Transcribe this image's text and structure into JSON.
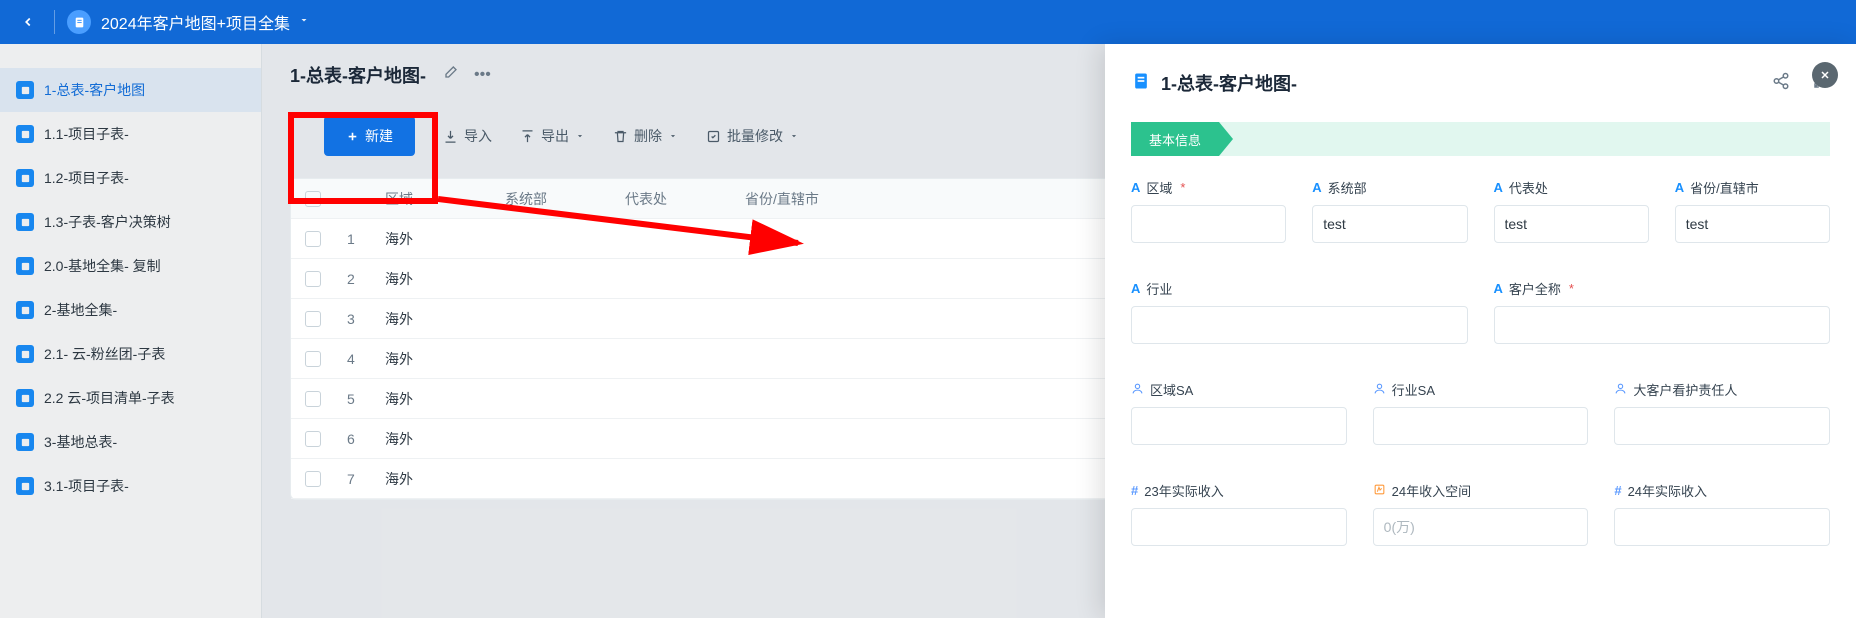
{
  "topbar": {
    "title": "2024年客户地图+项目全集"
  },
  "sidebar": {
    "items": [
      {
        "label": "1-总表-客户地图"
      },
      {
        "label": "1.1-项目子表-"
      },
      {
        "label": "1.2-项目子表-"
      },
      {
        "label": "1.3-子表-客户决策树"
      },
      {
        "label": "2.0-基地全集-      复制"
      },
      {
        "label": "2-基地全集-"
      },
      {
        "label": "2.1-    云-粉丝团-子表"
      },
      {
        "label": "2.2    云-项目清单-子表"
      },
      {
        "label": "3-基地总表-"
      },
      {
        "label": "3.1-项目子表-"
      }
    ]
  },
  "page": {
    "title": "1-总表-客户地图-"
  },
  "toolbar": {
    "new": "新建",
    "import": "导入",
    "export": "导出",
    "delete": "删除",
    "batch": "批量修改"
  },
  "table": {
    "headers": {
      "region": "区域",
      "sysdept": "系统部",
      "rep": "代表处",
      "province": "省份/直辖市"
    },
    "rows": [
      {
        "idx": "1",
        "region": "海外"
      },
      {
        "idx": "2",
        "region": "海外"
      },
      {
        "idx": "3",
        "region": "海外"
      },
      {
        "idx": "4",
        "region": "海外"
      },
      {
        "idx": "5",
        "region": "海外"
      },
      {
        "idx": "6",
        "region": "海外"
      },
      {
        "idx": "7",
        "region": "海外"
      }
    ]
  },
  "drawer": {
    "title": "1-总表-客户地图-",
    "section": "基本信息",
    "fields": {
      "region": {
        "label": "区域",
        "value": ""
      },
      "sysdept": {
        "label": "系统部",
        "value": "test"
      },
      "rep": {
        "label": "代表处",
        "value": "test"
      },
      "province": {
        "label": "省份/直辖市",
        "value": "test"
      },
      "industry": {
        "label": "行业",
        "value": ""
      },
      "customer": {
        "label": "客户全称",
        "value": ""
      },
      "regionSA": {
        "label": "区域SA",
        "value": ""
      },
      "industrySA": {
        "label": "行业SA",
        "value": ""
      },
      "keyOwner": {
        "label": "大客户看护责任人",
        "value": ""
      },
      "rev23": {
        "label": "23年实际收入",
        "value": ""
      },
      "space24": {
        "label": "24年收入空间",
        "placeholder": "0(万)"
      },
      "rev24": {
        "label": "24年实际收入",
        "value": ""
      }
    }
  }
}
